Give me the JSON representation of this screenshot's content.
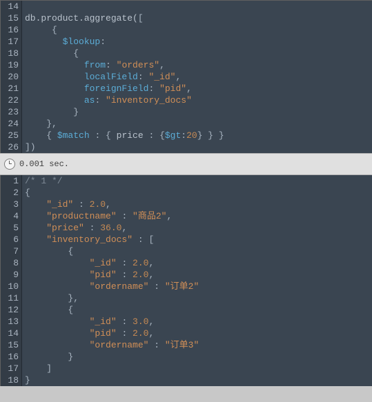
{
  "upper": {
    "lines": [
      {
        "num": 14,
        "segs": []
      },
      {
        "num": 15,
        "segs": [
          {
            "t": "plain",
            "v": "db.product.aggregate("
          },
          {
            "t": "op",
            "v": "["
          }
        ]
      },
      {
        "num": 16,
        "segs": [
          {
            "t": "plain",
            "v": "     "
          },
          {
            "t": "op",
            "v": "{"
          }
        ]
      },
      {
        "num": 17,
        "segs": [
          {
            "t": "plain",
            "v": "       "
          },
          {
            "t": "kw",
            "v": "$lookup"
          },
          {
            "t": "op",
            "v": ":"
          }
        ]
      },
      {
        "num": 18,
        "segs": [
          {
            "t": "plain",
            "v": "         "
          },
          {
            "t": "op",
            "v": "{"
          }
        ]
      },
      {
        "num": 19,
        "segs": [
          {
            "t": "plain",
            "v": "           "
          },
          {
            "t": "kw",
            "v": "from"
          },
          {
            "t": "op",
            "v": ": "
          },
          {
            "t": "str",
            "v": "\"orders\""
          },
          {
            "t": "op",
            "v": ","
          }
        ]
      },
      {
        "num": 20,
        "segs": [
          {
            "t": "plain",
            "v": "           "
          },
          {
            "t": "kw",
            "v": "localField"
          },
          {
            "t": "op",
            "v": ": "
          },
          {
            "t": "str",
            "v": "\"_id\""
          },
          {
            "t": "op",
            "v": ","
          }
        ]
      },
      {
        "num": 21,
        "segs": [
          {
            "t": "plain",
            "v": "           "
          },
          {
            "t": "kw",
            "v": "foreignField"
          },
          {
            "t": "op",
            "v": ": "
          },
          {
            "t": "str",
            "v": "\"pid\""
          },
          {
            "t": "op",
            "v": ","
          }
        ]
      },
      {
        "num": 22,
        "segs": [
          {
            "t": "plain",
            "v": "           "
          },
          {
            "t": "kw",
            "v": "as"
          },
          {
            "t": "op",
            "v": ": "
          },
          {
            "t": "str",
            "v": "\"inventory_docs\""
          }
        ]
      },
      {
        "num": 23,
        "segs": [
          {
            "t": "plain",
            "v": "         "
          },
          {
            "t": "op",
            "v": "}"
          }
        ]
      },
      {
        "num": 24,
        "segs": [
          {
            "t": "plain",
            "v": "    "
          },
          {
            "t": "op",
            "v": "},"
          }
        ]
      },
      {
        "num": 25,
        "segs": [
          {
            "t": "plain",
            "v": "    "
          },
          {
            "t": "op",
            "v": "{ "
          },
          {
            "t": "kw",
            "v": "$match"
          },
          {
            "t": "op",
            "v": " : { "
          },
          {
            "t": "plain",
            "v": "price "
          },
          {
            "t": "op",
            "v": ": {"
          },
          {
            "t": "kw",
            "v": "$gt"
          },
          {
            "t": "op",
            "v": ":"
          },
          {
            "t": "num",
            "v": "20"
          },
          {
            "t": "op",
            "v": "} } }"
          }
        ]
      },
      {
        "num": 26,
        "segs": [
          {
            "t": "op",
            "v": "])"
          }
        ]
      }
    ]
  },
  "status": {
    "text": "0.001 sec."
  },
  "lower": {
    "lines": [
      {
        "num": 1,
        "segs": [
          {
            "t": "cmt",
            "v": "/* 1 */"
          }
        ]
      },
      {
        "num": 2,
        "segs": [
          {
            "t": "op",
            "v": "{"
          }
        ]
      },
      {
        "num": 3,
        "segs": [
          {
            "t": "plain",
            "v": "    "
          },
          {
            "t": "key",
            "v": "\"_id\""
          },
          {
            "t": "op",
            "v": " : "
          },
          {
            "t": "val-num",
            "v": "2.0"
          },
          {
            "t": "op",
            "v": ","
          }
        ]
      },
      {
        "num": 4,
        "segs": [
          {
            "t": "plain",
            "v": "    "
          },
          {
            "t": "key",
            "v": "\"productname\""
          },
          {
            "t": "op",
            "v": " : "
          },
          {
            "t": "str",
            "v": "\"商品2\""
          },
          {
            "t": "op",
            "v": ","
          }
        ]
      },
      {
        "num": 5,
        "segs": [
          {
            "t": "plain",
            "v": "    "
          },
          {
            "t": "key",
            "v": "\"price\""
          },
          {
            "t": "op",
            "v": " : "
          },
          {
            "t": "val-num",
            "v": "36.0"
          },
          {
            "t": "op",
            "v": ","
          }
        ]
      },
      {
        "num": 6,
        "segs": [
          {
            "t": "plain",
            "v": "    "
          },
          {
            "t": "key",
            "v": "\"inventory_docs\""
          },
          {
            "t": "op",
            "v": " : ["
          }
        ]
      },
      {
        "num": 7,
        "segs": [
          {
            "t": "plain",
            "v": "        "
          },
          {
            "t": "op",
            "v": "{"
          }
        ]
      },
      {
        "num": 8,
        "segs": [
          {
            "t": "plain",
            "v": "            "
          },
          {
            "t": "key",
            "v": "\"_id\""
          },
          {
            "t": "op",
            "v": " : "
          },
          {
            "t": "val-num",
            "v": "2.0"
          },
          {
            "t": "op",
            "v": ","
          }
        ]
      },
      {
        "num": 9,
        "segs": [
          {
            "t": "plain",
            "v": "            "
          },
          {
            "t": "key",
            "v": "\"pid\""
          },
          {
            "t": "op",
            "v": " : "
          },
          {
            "t": "val-num",
            "v": "2.0"
          },
          {
            "t": "op",
            "v": ","
          }
        ]
      },
      {
        "num": 10,
        "segs": [
          {
            "t": "plain",
            "v": "            "
          },
          {
            "t": "key",
            "v": "\"ordername\""
          },
          {
            "t": "op",
            "v": " : "
          },
          {
            "t": "str",
            "v": "\"订单2\""
          }
        ]
      },
      {
        "num": 11,
        "segs": [
          {
            "t": "plain",
            "v": "        "
          },
          {
            "t": "op",
            "v": "},"
          }
        ]
      },
      {
        "num": 12,
        "segs": [
          {
            "t": "plain",
            "v": "        "
          },
          {
            "t": "op",
            "v": "{"
          }
        ]
      },
      {
        "num": 13,
        "segs": [
          {
            "t": "plain",
            "v": "            "
          },
          {
            "t": "key",
            "v": "\"_id\""
          },
          {
            "t": "op",
            "v": " : "
          },
          {
            "t": "val-num",
            "v": "3.0"
          },
          {
            "t": "op",
            "v": ","
          }
        ]
      },
      {
        "num": 14,
        "segs": [
          {
            "t": "plain",
            "v": "            "
          },
          {
            "t": "key",
            "v": "\"pid\""
          },
          {
            "t": "op",
            "v": " : "
          },
          {
            "t": "val-num",
            "v": "2.0"
          },
          {
            "t": "op",
            "v": ","
          }
        ]
      },
      {
        "num": 15,
        "segs": [
          {
            "t": "plain",
            "v": "            "
          },
          {
            "t": "key",
            "v": "\"ordername\""
          },
          {
            "t": "op",
            "v": " : "
          },
          {
            "t": "str",
            "v": "\"订单3\""
          }
        ]
      },
      {
        "num": 16,
        "segs": [
          {
            "t": "plain",
            "v": "        "
          },
          {
            "t": "op",
            "v": "}"
          }
        ]
      },
      {
        "num": 17,
        "segs": [
          {
            "t": "plain",
            "v": "    "
          },
          {
            "t": "op",
            "v": "]"
          }
        ]
      },
      {
        "num": 18,
        "segs": [
          {
            "t": "op",
            "v": "}"
          }
        ]
      }
    ]
  }
}
